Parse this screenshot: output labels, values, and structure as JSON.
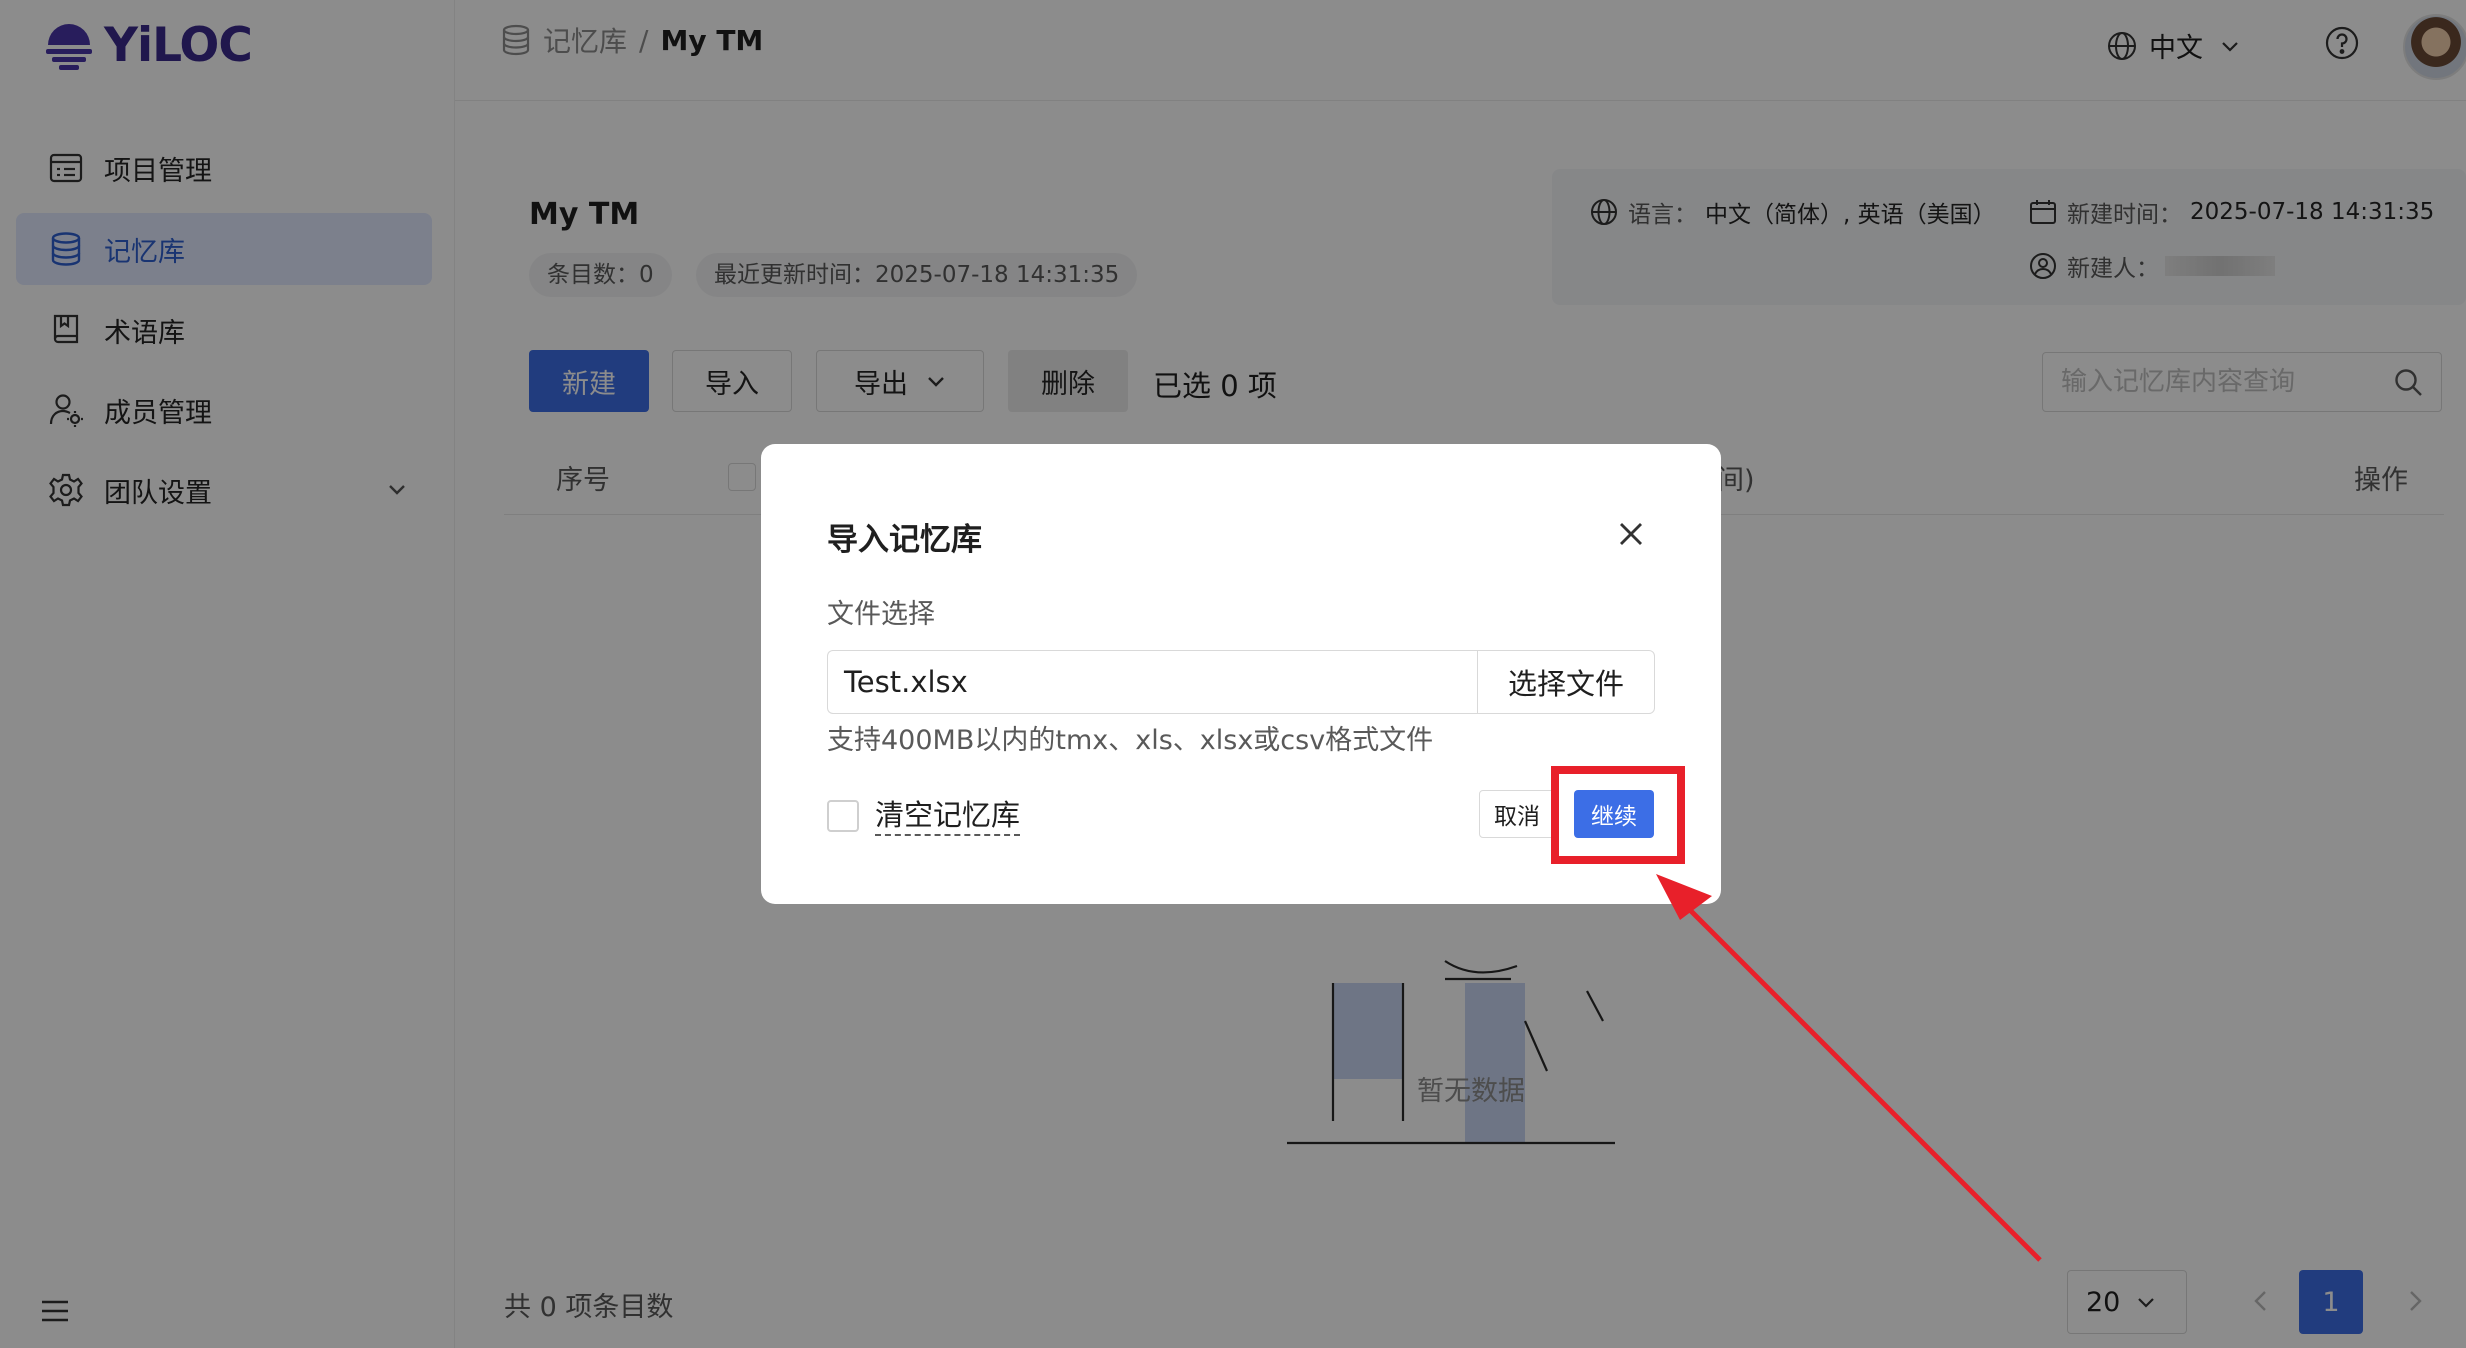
{
  "app": {
    "logo_text": "YiLOC"
  },
  "sidebar": {
    "items": [
      {
        "label": "项目管理",
        "icon": "list-icon",
        "active": false
      },
      {
        "label": "记忆库",
        "icon": "database-icon",
        "active": true
      },
      {
        "label": "术语库",
        "icon": "book-icon",
        "active": false
      },
      {
        "label": "成员管理",
        "icon": "user-settings-icon",
        "active": false
      },
      {
        "label": "团队设置",
        "icon": "gear-icon",
        "active": false
      }
    ]
  },
  "header": {
    "breadcrumb_parent": "记忆库",
    "breadcrumb_sep": "/",
    "breadcrumb_current": "My TM",
    "language": "中文"
  },
  "tm": {
    "name": "My TM",
    "entry_count": "条目数：0",
    "last_updated": "最近更新时间：2025-07-18 14:31:35",
    "lang_label": "语言：",
    "lang_value": "中文（简体）, 英语（美国）",
    "created_label": "新建时间：",
    "created_value": "2025-07-18 14:31:35",
    "creator_label": "新建人："
  },
  "toolbar": {
    "new": "新建",
    "import": "导入",
    "export": "导出",
    "delete": "删除",
    "selected": "已选 0 项",
    "search_placeholder": "输入记忆库内容查询"
  },
  "table": {
    "col_index": "序号",
    "col_partial": "间)",
    "col_actions": "操作",
    "empty": "暂无数据"
  },
  "footer": {
    "total": "共 0 项条目数",
    "page_size": "20",
    "current_page": "1"
  },
  "modal": {
    "title": "导入记忆库",
    "field_label": "文件选择",
    "file_value": "Test.xlsx",
    "choose_button": "选择文件",
    "hint": "支持400MB以内的tmx、xls、xlsx或csv格式文件",
    "clear_label": "清空记忆库",
    "cancel": "取消",
    "continue": "继续"
  },
  "colors": {
    "accent": "#3c6ee6",
    "annotation": "#e8202a",
    "brand": "#3b2a8c"
  }
}
